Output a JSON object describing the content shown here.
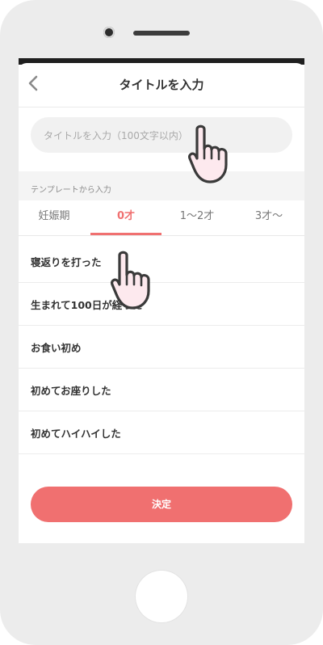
{
  "screen": {
    "title": "タイトルを入力",
    "back_icon": "chevron-left-icon"
  },
  "title_input": {
    "placeholder": "タイトルを入力（100文字以内）",
    "value": ""
  },
  "template_section": {
    "label": "テンプレートから入力"
  },
  "tabs": [
    {
      "label": "妊娠期",
      "active": false
    },
    {
      "label": "0才",
      "active": true
    },
    {
      "label": "1〜2才",
      "active": false
    },
    {
      "label": "3才〜",
      "active": false
    }
  ],
  "templates": [
    {
      "label": "寝返りを打った"
    },
    {
      "label": "生まれて100日が経った"
    },
    {
      "label": "お食い初め"
    },
    {
      "label": "初めてお座りした"
    },
    {
      "label": "初めてハイハイした"
    }
  ],
  "submit_button": {
    "label": "決定"
  },
  "colors": {
    "accent": "#f07070",
    "device_body": "#ececec",
    "input_bg": "#f1f1f1",
    "hand_fill": "#fde9ee"
  },
  "overlays": {
    "hand_icon": "pointing-hand-icon"
  }
}
